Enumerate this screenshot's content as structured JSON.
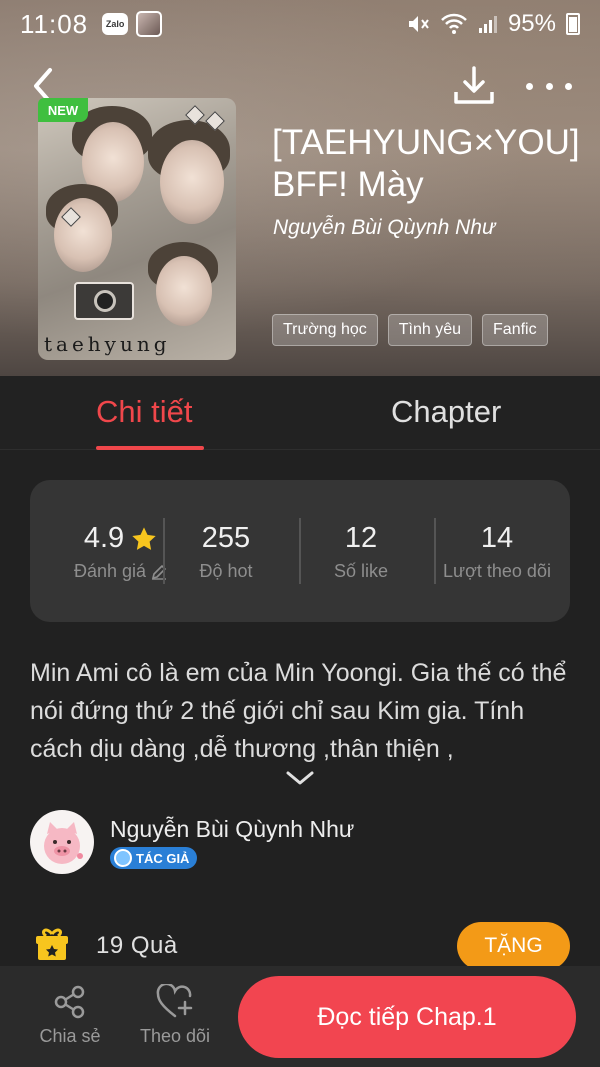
{
  "status_bar": {
    "time": "11:08",
    "battery": "95%",
    "zalo_label": "Zalo"
  },
  "book": {
    "badge": "NEW",
    "cover_text": "taehyung",
    "title": "[TAEHYUNG×YOU] BFF! Mày",
    "author": "Nguyễn Bùi Qùynh Như",
    "tags": [
      "Trường học",
      "Tình yêu",
      "Fanfic"
    ]
  },
  "tabs": [
    {
      "label": "Chi tiết",
      "active": true
    },
    {
      "label": "Chapter",
      "active": false
    }
  ],
  "stats": [
    {
      "value": "4.9",
      "label": "Đánh giá",
      "icon": "star-icon"
    },
    {
      "value": "255",
      "label": "Độ hot"
    },
    {
      "value": "12",
      "label": "Số like"
    },
    {
      "value": "14",
      "label": "Lượt theo dõi"
    }
  ],
  "description": "Min Ami cô là em của Min Yoongi. Gia thế có thể nói đứng thứ 2 thế giới chỉ sau Kim gia. Tính cách dịu dàng ,dễ thương ,thân thiện ,",
  "author_block": {
    "name": "Nguyễn Bùi Qùynh Như",
    "badge": "TÁC GIẢ"
  },
  "gifts": {
    "text": "19 Quà",
    "button": "TẶNG"
  },
  "bottom_bar": {
    "share": "Chia sẻ",
    "follow": "Theo dõi",
    "read": "Đọc tiếp Chap.1"
  },
  "colors": {
    "accent": "#f0474b",
    "gift_button": "#f39a17",
    "background": "#212121"
  }
}
